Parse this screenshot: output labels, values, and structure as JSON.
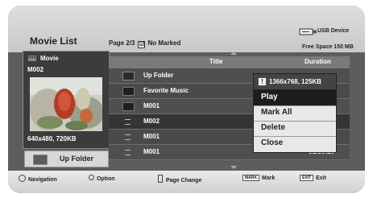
{
  "header": {
    "title": "Movie List",
    "page_info": "Page 2/3",
    "marked_checkbox": "☑",
    "marked_label": "No Marked",
    "device_label": "USB Device",
    "free_space": "Free Space 150 MB"
  },
  "left_panel": {
    "category": "Movie",
    "filename": "M002",
    "resolution": "640x480, 720KB",
    "up_folder_label": "Up Folder"
  },
  "list": {
    "columns": {
      "title": "Title",
      "duration": "Duration"
    },
    "rows": [
      {
        "name": "Up Folder",
        "duration": ""
      },
      {
        "name": "Favorite Music",
        "duration": ""
      },
      {
        "name": "M001",
        "duration": ""
      },
      {
        "name": "M002",
        "duration": ""
      },
      {
        "name": "M001",
        "duration": ""
      },
      {
        "name": "M001",
        "duration": "01:30:20"
      }
    ]
  },
  "popup": {
    "info_icon": "!",
    "info": "1366x768, 125KB",
    "items": [
      "Play",
      "Mark All",
      "Delete",
      "Close"
    ]
  },
  "footer": {
    "navigation": "Navigation",
    "option": "Option",
    "page_change": "Page Change",
    "mark_key": "MARK",
    "mark": "Mark",
    "exit_key": "EXIT",
    "exit": "Exit"
  }
}
